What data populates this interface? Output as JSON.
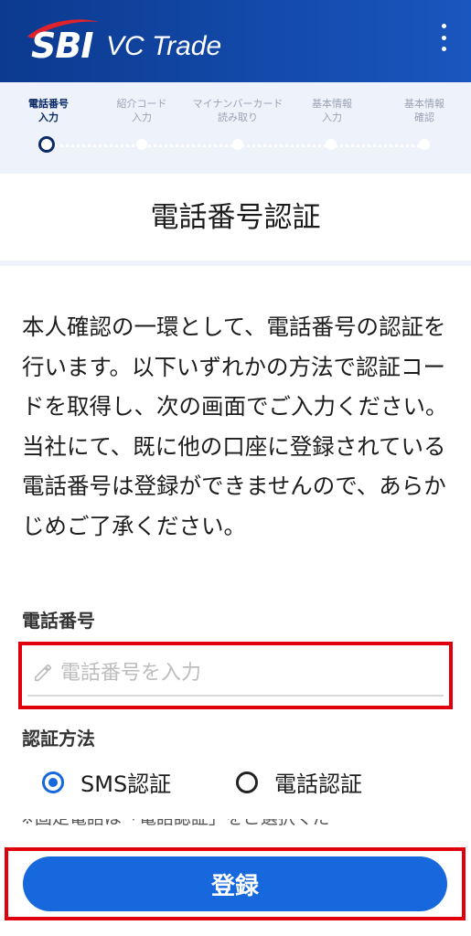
{
  "header": {
    "logo_sbi": "SBI",
    "logo_vc": "VC Trade",
    "menu_icon": "more-vertical-icon"
  },
  "steps": [
    {
      "line1": "電話番号",
      "line2": "入力",
      "active": true
    },
    {
      "line1": "紹介コード",
      "line2": "入力",
      "active": false
    },
    {
      "line1": "マイナンバーカード",
      "line2": "読み取り",
      "active": false
    },
    {
      "line1": "基本情報",
      "line2": "入力",
      "active": false
    },
    {
      "line1": "基本情報",
      "line2": "確認",
      "active": false
    }
  ],
  "page_title": "電話番号認証",
  "description": {
    "p1": "本人確認の一環として、電話番号の認証を行います。以下いずれかの方法で認証コードを取得し、次の画面でご入力ください。",
    "p2": "当社にて、既に他の口座に登録されている電話番号は登録ができませんので、あらかじめご了承ください。"
  },
  "phone": {
    "label": "電話番号",
    "placeholder": "電話番号を入力",
    "value": ""
  },
  "method": {
    "label": "認証方法",
    "options": [
      {
        "label": "SMS認証",
        "checked": true
      },
      {
        "label": "電話認証",
        "checked": false
      }
    ]
  },
  "note": "※固定電話は「電話認証」をご選択くだ",
  "submit_label": "登録",
  "colors": {
    "header": "#0b3a8f",
    "accent": "#1668dc",
    "highlight": "#e0000d",
    "step_active": "#0b2a66"
  }
}
